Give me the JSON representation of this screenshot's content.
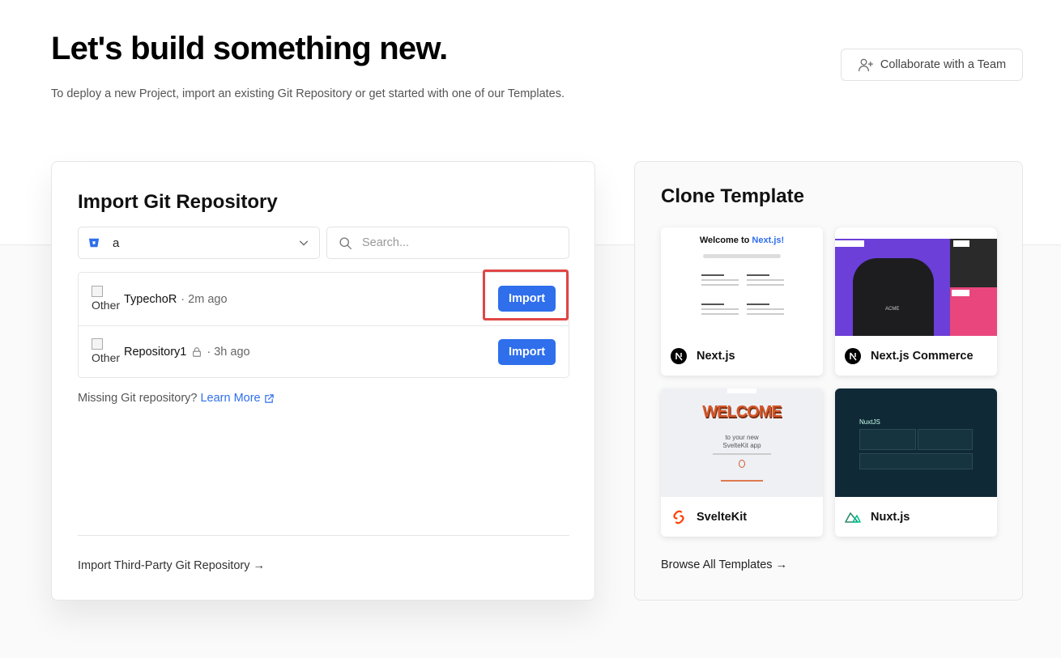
{
  "header": {
    "title": "Let's build something new.",
    "subtitle": "To deploy a new Project, import an existing Git Repository or get started with one of our Templates.",
    "collaborate_label": "Collaborate with a Team"
  },
  "import": {
    "title": "Import Git Repository",
    "account": "a",
    "search_placeholder": "Search...",
    "repos": [
      {
        "avatar_alt": "Other",
        "name": "TypechoR",
        "meta": "· 2m ago",
        "private": false,
        "action": "Import"
      },
      {
        "avatar_alt": "Other",
        "name": "Repository1",
        "meta": "· 3h ago",
        "private": true,
        "action": "Import"
      }
    ],
    "missing_text": "Missing Git repository?",
    "learn_more": "Learn More",
    "third_party": "Import Third-Party Git Repository →"
  },
  "clone": {
    "title": "Clone Template",
    "templates": [
      {
        "name": "Next.js",
        "icon": "nextjs-icon"
      },
      {
        "name": "Next.js Commerce",
        "icon": "nextjs-icon"
      },
      {
        "name": "SvelteKit",
        "icon": "svelte-icon"
      },
      {
        "name": "Nuxt.js",
        "icon": "nuxt-icon"
      }
    ],
    "browse_all": "Browse All Templates →",
    "thumbs": {
      "next_heading_a": "Welcome to ",
      "next_heading_b": "Next.js!",
      "commerce_brand": "ACME",
      "svelte_welcome": "WELCOME",
      "svelte_line1": "to your new",
      "svelte_line2": "SvelteKit app",
      "nuxt_logo": "NuxtJS"
    }
  },
  "colors": {
    "accent": "#2f6fec",
    "highlight": "#e04646"
  }
}
